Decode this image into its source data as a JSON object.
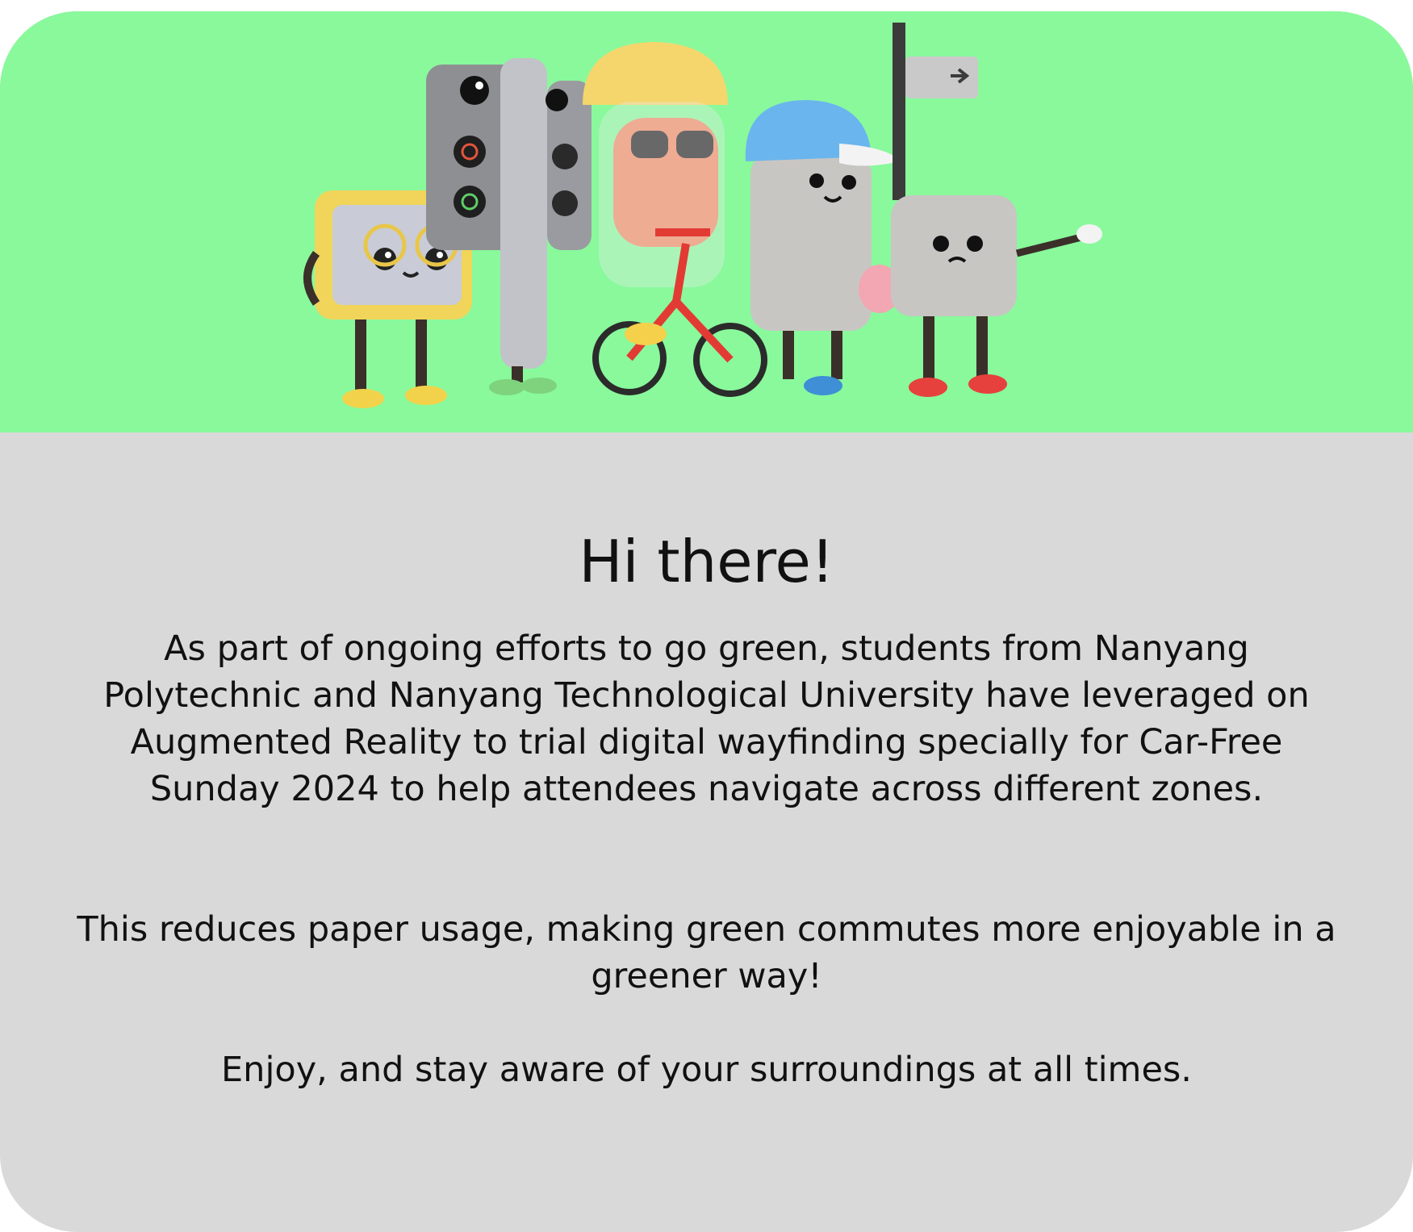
{
  "hero": {
    "illustration": "mascot-characters-illustration",
    "background_color": "#89f99c"
  },
  "welcome": {
    "title": "Hi there!",
    "paragraphs": [
      "As part of ongoing efforts to go green, students from Nanyang Polytechnic and Nanyang Technological University have leveraged on Augmented Reality to trial digital wayfinding specially for Car-Free Sunday 2024 to help attendees navigate across different zones.",
      "This reduces paper usage, making green commutes more enjoyable in a greener way!",
      "Enjoy, and stay aware of your surroundings at all times."
    ]
  },
  "colors": {
    "card_background": "#d9d9d9",
    "hero_background": "#89f99c",
    "text": "#111111"
  }
}
